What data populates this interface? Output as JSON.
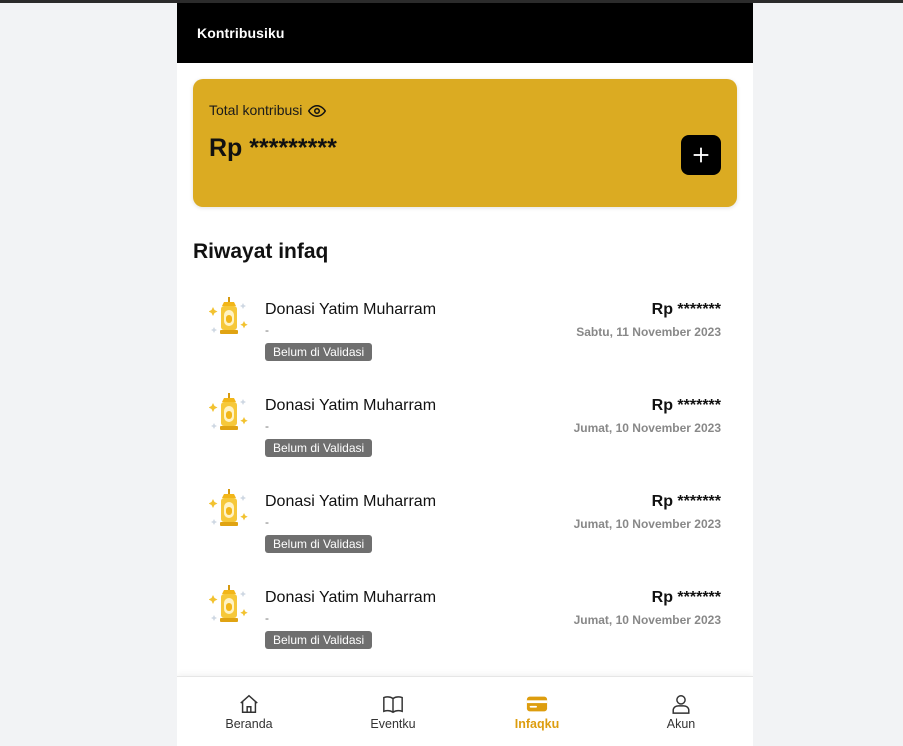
{
  "header": {
    "title": "Kontribusiku"
  },
  "summary": {
    "label": "Total kontribusi",
    "amount": "Rp *********",
    "eye_icon": "eye-icon",
    "add_icon": "plus-icon"
  },
  "history": {
    "title": "Riwayat infaq",
    "items": [
      {
        "title": "Donasi Yatim Muharram",
        "subtitle": "-",
        "status": "Belum di Validasi",
        "amount": "Rp *******",
        "date": "Sabtu, 11 November 2023"
      },
      {
        "title": "Donasi Yatim Muharram",
        "subtitle": "-",
        "status": "Belum di Validasi",
        "amount": "Rp *******",
        "date": "Jumat, 10 November 2023"
      },
      {
        "title": "Donasi Yatim Muharram",
        "subtitle": "-",
        "status": "Belum di Validasi",
        "amount": "Rp *******",
        "date": "Jumat, 10 November 2023"
      },
      {
        "title": "Donasi Yatim Muharram",
        "subtitle": "-",
        "status": "Belum di Validasi",
        "amount": "Rp *******",
        "date": "Jumat, 10 November 2023"
      }
    ]
  },
  "nav": {
    "items": [
      {
        "label": "Beranda",
        "icon": "home-icon"
      },
      {
        "label": "Eventku",
        "icon": "book-icon"
      },
      {
        "label": "Infaqku",
        "icon": "card-icon",
        "active": true
      },
      {
        "label": "Akun",
        "icon": "user-icon"
      }
    ]
  },
  "colors": {
    "accent": "#dbab22",
    "nav_active": "#dd9d0e",
    "badge": "#6f6f6f"
  }
}
